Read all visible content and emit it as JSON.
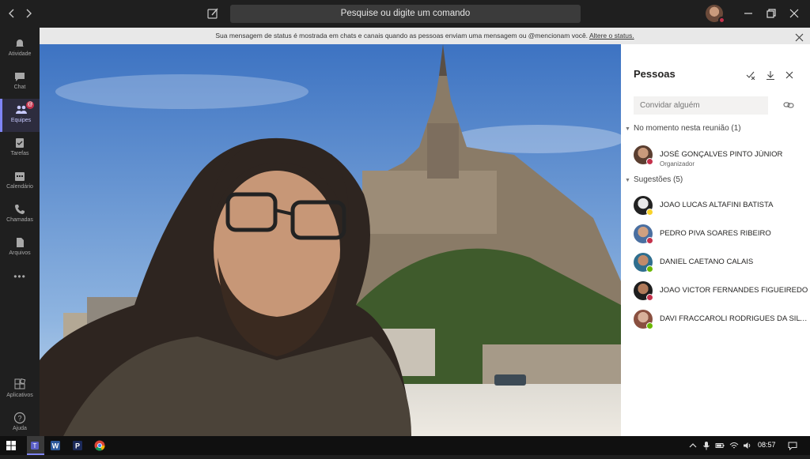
{
  "titlebar": {
    "search_placeholder": "Pesquise ou digite um comando"
  },
  "rail": {
    "items": [
      {
        "label": "Atividade",
        "icon": "bell-icon"
      },
      {
        "label": "Chat",
        "icon": "chat-icon"
      },
      {
        "label": "Equipes",
        "icon": "teams-icon",
        "active": true,
        "badge": "@"
      },
      {
        "label": "Tarefas",
        "icon": "tasks-icon"
      },
      {
        "label": "Calendário",
        "icon": "calendar-icon"
      },
      {
        "label": "Chamadas",
        "icon": "phone-icon"
      },
      {
        "label": "Arquivos",
        "icon": "files-icon"
      }
    ],
    "more": "•••",
    "apps_label": "Aplicativos",
    "help_label": "Ajuda"
  },
  "banner": {
    "text": "Sua mensagem de status é mostrada em chats e canais quando as pessoas enviam uma mensagem ou @mencionam você.",
    "link": "Altere o status."
  },
  "people": {
    "title": "Pessoas",
    "invite_placeholder": "Convidar alguém",
    "in_meeting_label": "No momento nesta reunião (1)",
    "suggestions_label": "Sugestões (5)",
    "in_meeting": [
      {
        "name": "JOSÉ GONÇALVES PINTO JÚNIOR",
        "role": "Organizador",
        "status": "busy"
      }
    ],
    "suggestions": [
      {
        "name": "JOAO LUCAS ALTAFINI BATISTA",
        "status": "away"
      },
      {
        "name": "PEDRO PIVA SOARES RIBEIRO",
        "status": "busy"
      },
      {
        "name": "DANIEL CAETANO CALAIS",
        "status": "available"
      },
      {
        "name": "JOAO VICTOR FERNANDES FIGUEIREDO",
        "status": "busy"
      },
      {
        "name": "DAVI FRACCAROLI RODRIGUES DA SILVA",
        "status": "available"
      }
    ]
  },
  "taskbar": {
    "time": "08:57"
  },
  "colors": {
    "accent": "#7f85f5",
    "busy": "#c4314b",
    "available": "#6bb700",
    "away": "#f8d22a"
  }
}
